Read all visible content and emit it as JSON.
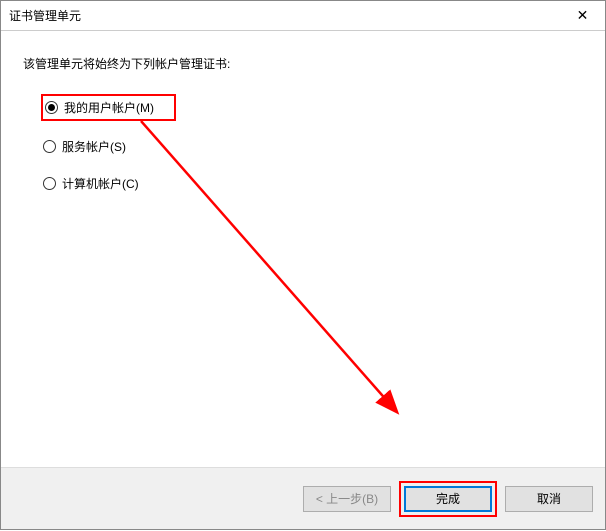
{
  "titlebar": {
    "title": "证书管理单元",
    "close_icon": "✕"
  },
  "content": {
    "description": "该管理单元将始终为下列帐户管理证书:"
  },
  "radios": {
    "my_user": {
      "label": "我的用户帐户(M)",
      "selected": true
    },
    "service": {
      "label": "服务帐户(S)",
      "selected": false
    },
    "computer": {
      "label": "计算机帐户(C)",
      "selected": false
    }
  },
  "footer": {
    "back_label": "< 上一步(B)",
    "finish_label": "完成",
    "cancel_label": "取消"
  }
}
